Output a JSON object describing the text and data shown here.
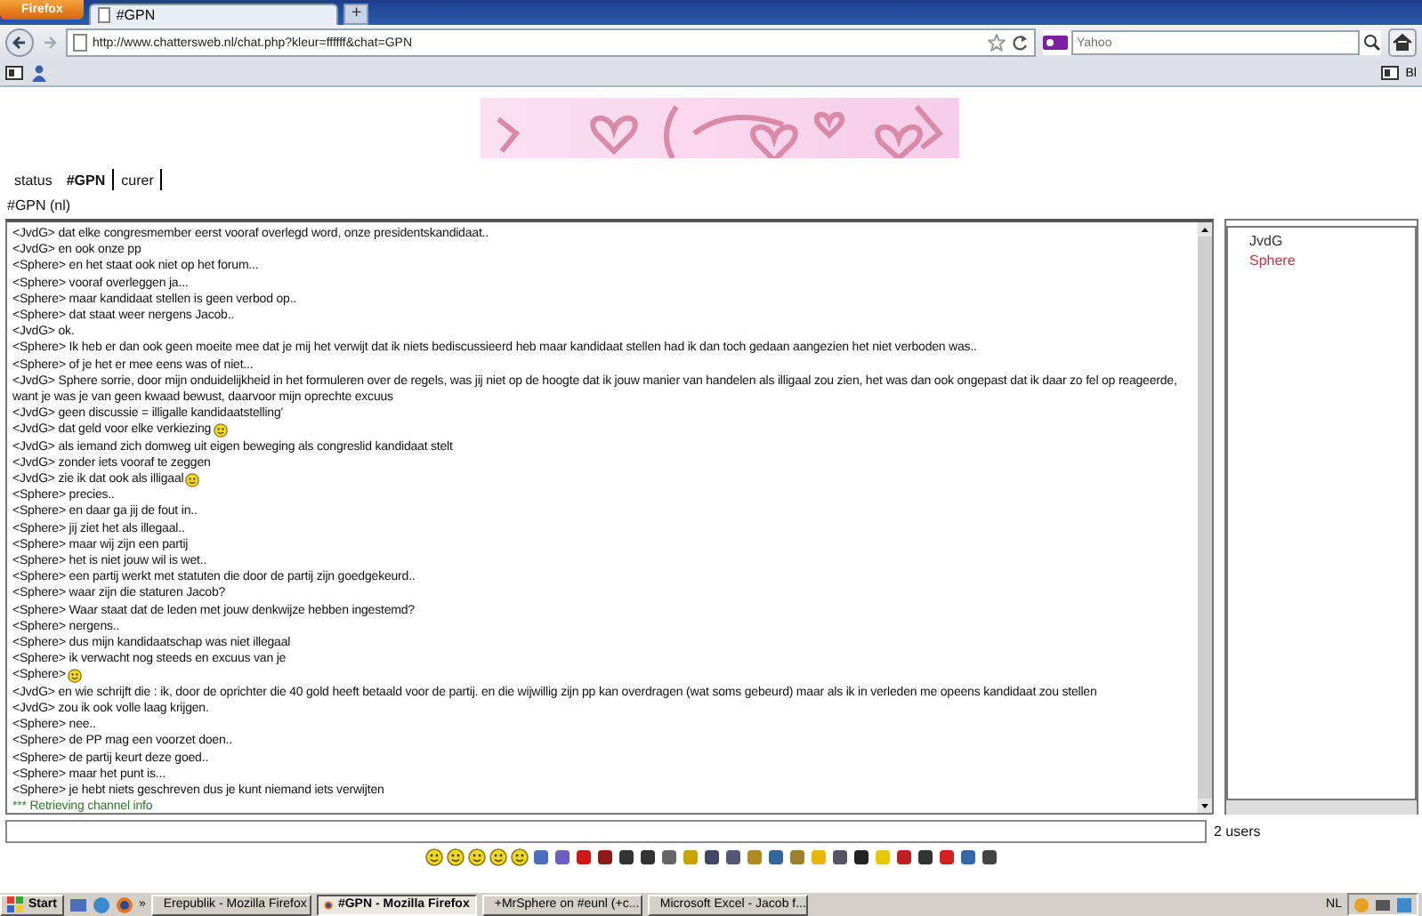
{
  "browser": {
    "app_button": "Firefox",
    "tabs": [
      {
        "title": "#GPN",
        "selected": true
      }
    ],
    "new_tab": "+",
    "url": "http://www.chattersweb.nl/chat.php?kleur=ffffff&chat=GPN",
    "search_placeholder": "Yahoo",
    "bookmark_cut": "Bl"
  },
  "chat_tabs": [
    {
      "label": "status",
      "selected": false
    },
    {
      "label": "#GPN",
      "selected": true
    },
    {
      "label": "curer",
      "selected": false
    }
  ],
  "channel_title": "#GPN (nl)",
  "messages": [
    {
      "kind": "message",
      "text": "<JvdG> dat elke congresmember eerst vooraf overlegd word, onze presidentskandidaat..",
      "smiley": false
    },
    {
      "kind": "message",
      "text": "<JvdG> en ook onze pp",
      "smiley": false
    },
    {
      "kind": "message",
      "text": "<Sphere> en het staat ook niet op het forum...",
      "smiley": false
    },
    {
      "kind": "message",
      "text": "<Sphere> vooraf overleggen ja...",
      "smiley": false
    },
    {
      "kind": "message",
      "text": "<Sphere> maar kandidaat stellen is geen verbod op..",
      "smiley": false
    },
    {
      "kind": "message",
      "text": "<Sphere> dat staat weer nergens Jacob..",
      "smiley": false
    },
    {
      "kind": "message",
      "text": "<JvdG> ok.",
      "smiley": false
    },
    {
      "kind": "message",
      "text": "<Sphere> Ik heb er dan ook geen moeite mee dat je mij het verwijt dat ik niets bediscussieerd heb maar kandidaat stellen had ik dan toch gedaan aangezien het niet verboden was..",
      "smiley": false
    },
    {
      "kind": "message",
      "text": "<Sphere> of je het er mee eens was of niet...",
      "smiley": false
    },
    {
      "kind": "message",
      "text": "<JvdG> Sphere sorrie, door mijn onduidelijkheid in het formuleren over de regels, was jij niet op de hoogte dat ik jouw manier van handelen als illigaal zou zien, het was dan ook ongepast dat ik daar zo fel op reageerde, want je was je van geen kwaad bewust, daarvoor mijn oprechte excuus",
      "smiley": false
    },
    {
      "kind": "message",
      "text": "<JvdG> geen discussie = illigalle kandidaatstelling'",
      "smiley": false
    },
    {
      "kind": "message",
      "text": "<JvdG> dat geld voor elke verkiezing",
      "smiley": true
    },
    {
      "kind": "message",
      "text": "<JvdG> als iemand zich domweg uit eigen beweging als congreslid kandidaat stelt",
      "smiley": false
    },
    {
      "kind": "message",
      "text": "<JvdG> zonder iets vooraf te zeggen",
      "smiley": false
    },
    {
      "kind": "message",
      "text": "<JvdG> zie ik dat ook als illigaal",
      "smiley": true
    },
    {
      "kind": "message",
      "text": "<Sphere> precies..",
      "smiley": false
    },
    {
      "kind": "message",
      "text": "<Sphere> en daar ga jij de fout in..",
      "smiley": false
    },
    {
      "kind": "message",
      "text": "<Sphere> jij ziet het als illegaal..",
      "smiley": false
    },
    {
      "kind": "message",
      "text": "<Sphere> maar wij zijn een partij",
      "smiley": false
    },
    {
      "kind": "message",
      "text": "<Sphere> het is niet jouw wil is wet..",
      "smiley": false
    },
    {
      "kind": "message",
      "text": "<Sphere> een partij werkt met statuten die door de partij zijn goedgekeurd..",
      "smiley": false
    },
    {
      "kind": "message",
      "text": "<Sphere> waar zijn die staturen Jacob?",
      "smiley": false
    },
    {
      "kind": "message",
      "text": "<Sphere> Waar staat dat de leden met jouw denkwijze hebben ingestemd?",
      "smiley": false
    },
    {
      "kind": "message",
      "text": "<Sphere> nergens..",
      "smiley": false
    },
    {
      "kind": "message",
      "text": "<Sphere> dus mijn kandidaatschap was niet illegaal",
      "smiley": false
    },
    {
      "kind": "message",
      "text": "<Sphere> ik verwacht nog steeds en excuus van je",
      "smiley": false
    },
    {
      "kind": "message",
      "text": "<Sphere>",
      "smiley": true
    },
    {
      "kind": "message",
      "text": "<JvdG> en wie schrijft die : ik, door de oprichter die 40 gold heeft betaald voor de partij. en die wijwillig zijn pp kan overdragen (wat soms gebeurd) maar als ik in verleden me opeens kandidaat zou stellen",
      "smiley": false
    },
    {
      "kind": "message",
      "text": "<JvdG> zou ik ook volle laag krijgen.",
      "smiley": false
    },
    {
      "kind": "message",
      "text": "<Sphere> nee..",
      "smiley": false
    },
    {
      "kind": "message",
      "text": "<Sphere> de PP mag een voorzet doen..",
      "smiley": false
    },
    {
      "kind": "message",
      "text": "<Sphere> de partij keurt deze goed..",
      "smiley": false
    },
    {
      "kind": "message",
      "text": "<Sphere> maar het punt is...",
      "smiley": false
    },
    {
      "kind": "message",
      "text": "<Sphere> je hebt niets geschreven dus je kunt niemand iets verwijten",
      "smiley": false
    },
    {
      "kind": "system",
      "text": "*** Retrieving channel info",
      "smiley": false
    }
  ],
  "users": [
    {
      "name": "JvdG",
      "color": "#333333"
    },
    {
      "name": "Sphere",
      "color": "#cc3344"
    }
  ],
  "user_count": "2 users",
  "taskbar": {
    "start": "Start",
    "more": "»",
    "tasks": [
      {
        "title": "Erepublik - Mozilla Firefox",
        "kind": "firefox",
        "selected": false
      },
      {
        "title": "#GPN - Mozilla Firefox",
        "kind": "firefox",
        "selected": true
      },
      {
        "title": "+MrSphere on #eunl (+c...",
        "kind": "irc",
        "selected": false
      },
      {
        "title": "Microsoft Excel - Jacob f...",
        "kind": "excel",
        "selected": false
      }
    ],
    "language": "NL"
  }
}
